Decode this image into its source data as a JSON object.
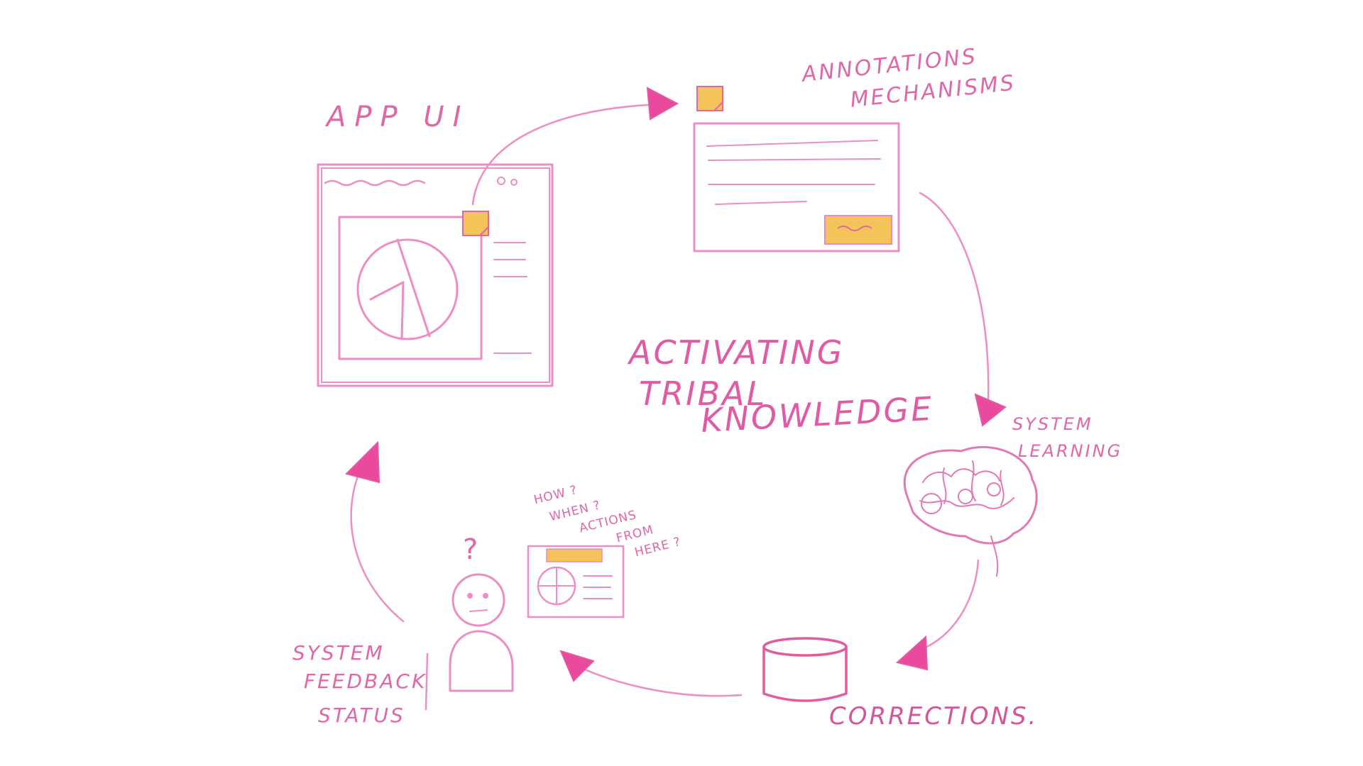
{
  "diagram": {
    "colors": {
      "stroke": "#ee8cc4",
      "stroke_dark": "#e05aa4",
      "arrow_fill": "#e94a9e",
      "sticky_note": "#f4c45a"
    },
    "labels": {
      "app_ui": "APP UI",
      "annotations_line1": "ANNOTATIONS",
      "annotations_line2": "MECHANISMS",
      "center_line1": "ACTIVATING",
      "center_line2": "TRIBAL",
      "center_line3": "KNOWLEDGE",
      "system_learning_line1": "SYSTEM",
      "system_learning_line2": "LEARNING",
      "corrections": "CORRECTIONS.",
      "feedback_line1": "SYSTEM",
      "feedback_line2": "FEEDBACK",
      "feedback_line3": "STATUS"
    },
    "questions": {
      "q1": "HOW ?",
      "q2": "WHEN ?",
      "q3": "ACTIONS",
      "q4": "FROM",
      "q5": "HERE ?",
      "confused_mark": "?"
    },
    "icons": {
      "sticky": "sticky-note-icon",
      "brain": "brain-icon",
      "database": "database-icon",
      "person": "person-icon",
      "arrow": "arrowhead-icon",
      "pie": "pie-chart-icon"
    }
  }
}
